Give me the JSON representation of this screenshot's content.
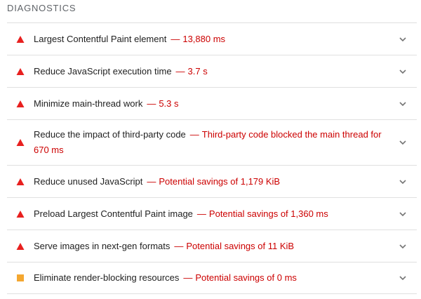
{
  "section": {
    "title": "DIAGNOSTICS"
  },
  "audits": [
    {
      "severity": "fail",
      "icon": "red-triangle-icon",
      "title": "Largest Contentful Paint element",
      "detail": "13,880 ms"
    },
    {
      "severity": "fail",
      "icon": "red-triangle-icon",
      "title": "Reduce JavaScript execution time",
      "detail": "3.7 s"
    },
    {
      "severity": "fail",
      "icon": "red-triangle-icon",
      "title": "Minimize main-thread work",
      "detail": "5.3 s"
    },
    {
      "severity": "fail",
      "icon": "red-triangle-icon",
      "title": "Reduce the impact of third-party code",
      "detail": "Third-party code blocked the main thread for 670 ms"
    },
    {
      "severity": "fail",
      "icon": "red-triangle-icon",
      "title": "Reduce unused JavaScript",
      "detail": "Potential savings of 1,179 KiB"
    },
    {
      "severity": "fail",
      "icon": "red-triangle-icon",
      "title": "Preload Largest Contentful Paint image",
      "detail": "Potential savings of 1,360 ms"
    },
    {
      "severity": "fail",
      "icon": "red-triangle-icon",
      "title": "Serve images in next-gen formats",
      "detail": "Potential savings of 11 KiB"
    },
    {
      "severity": "average",
      "icon": "orange-square-icon",
      "title": "Eliminate render-blocking resources",
      "detail": "Potential savings of 0 ms"
    }
  ],
  "separator": "—",
  "colors": {
    "fail": "#e8201f",
    "average": "#f4a730",
    "detail": "#c00000"
  }
}
